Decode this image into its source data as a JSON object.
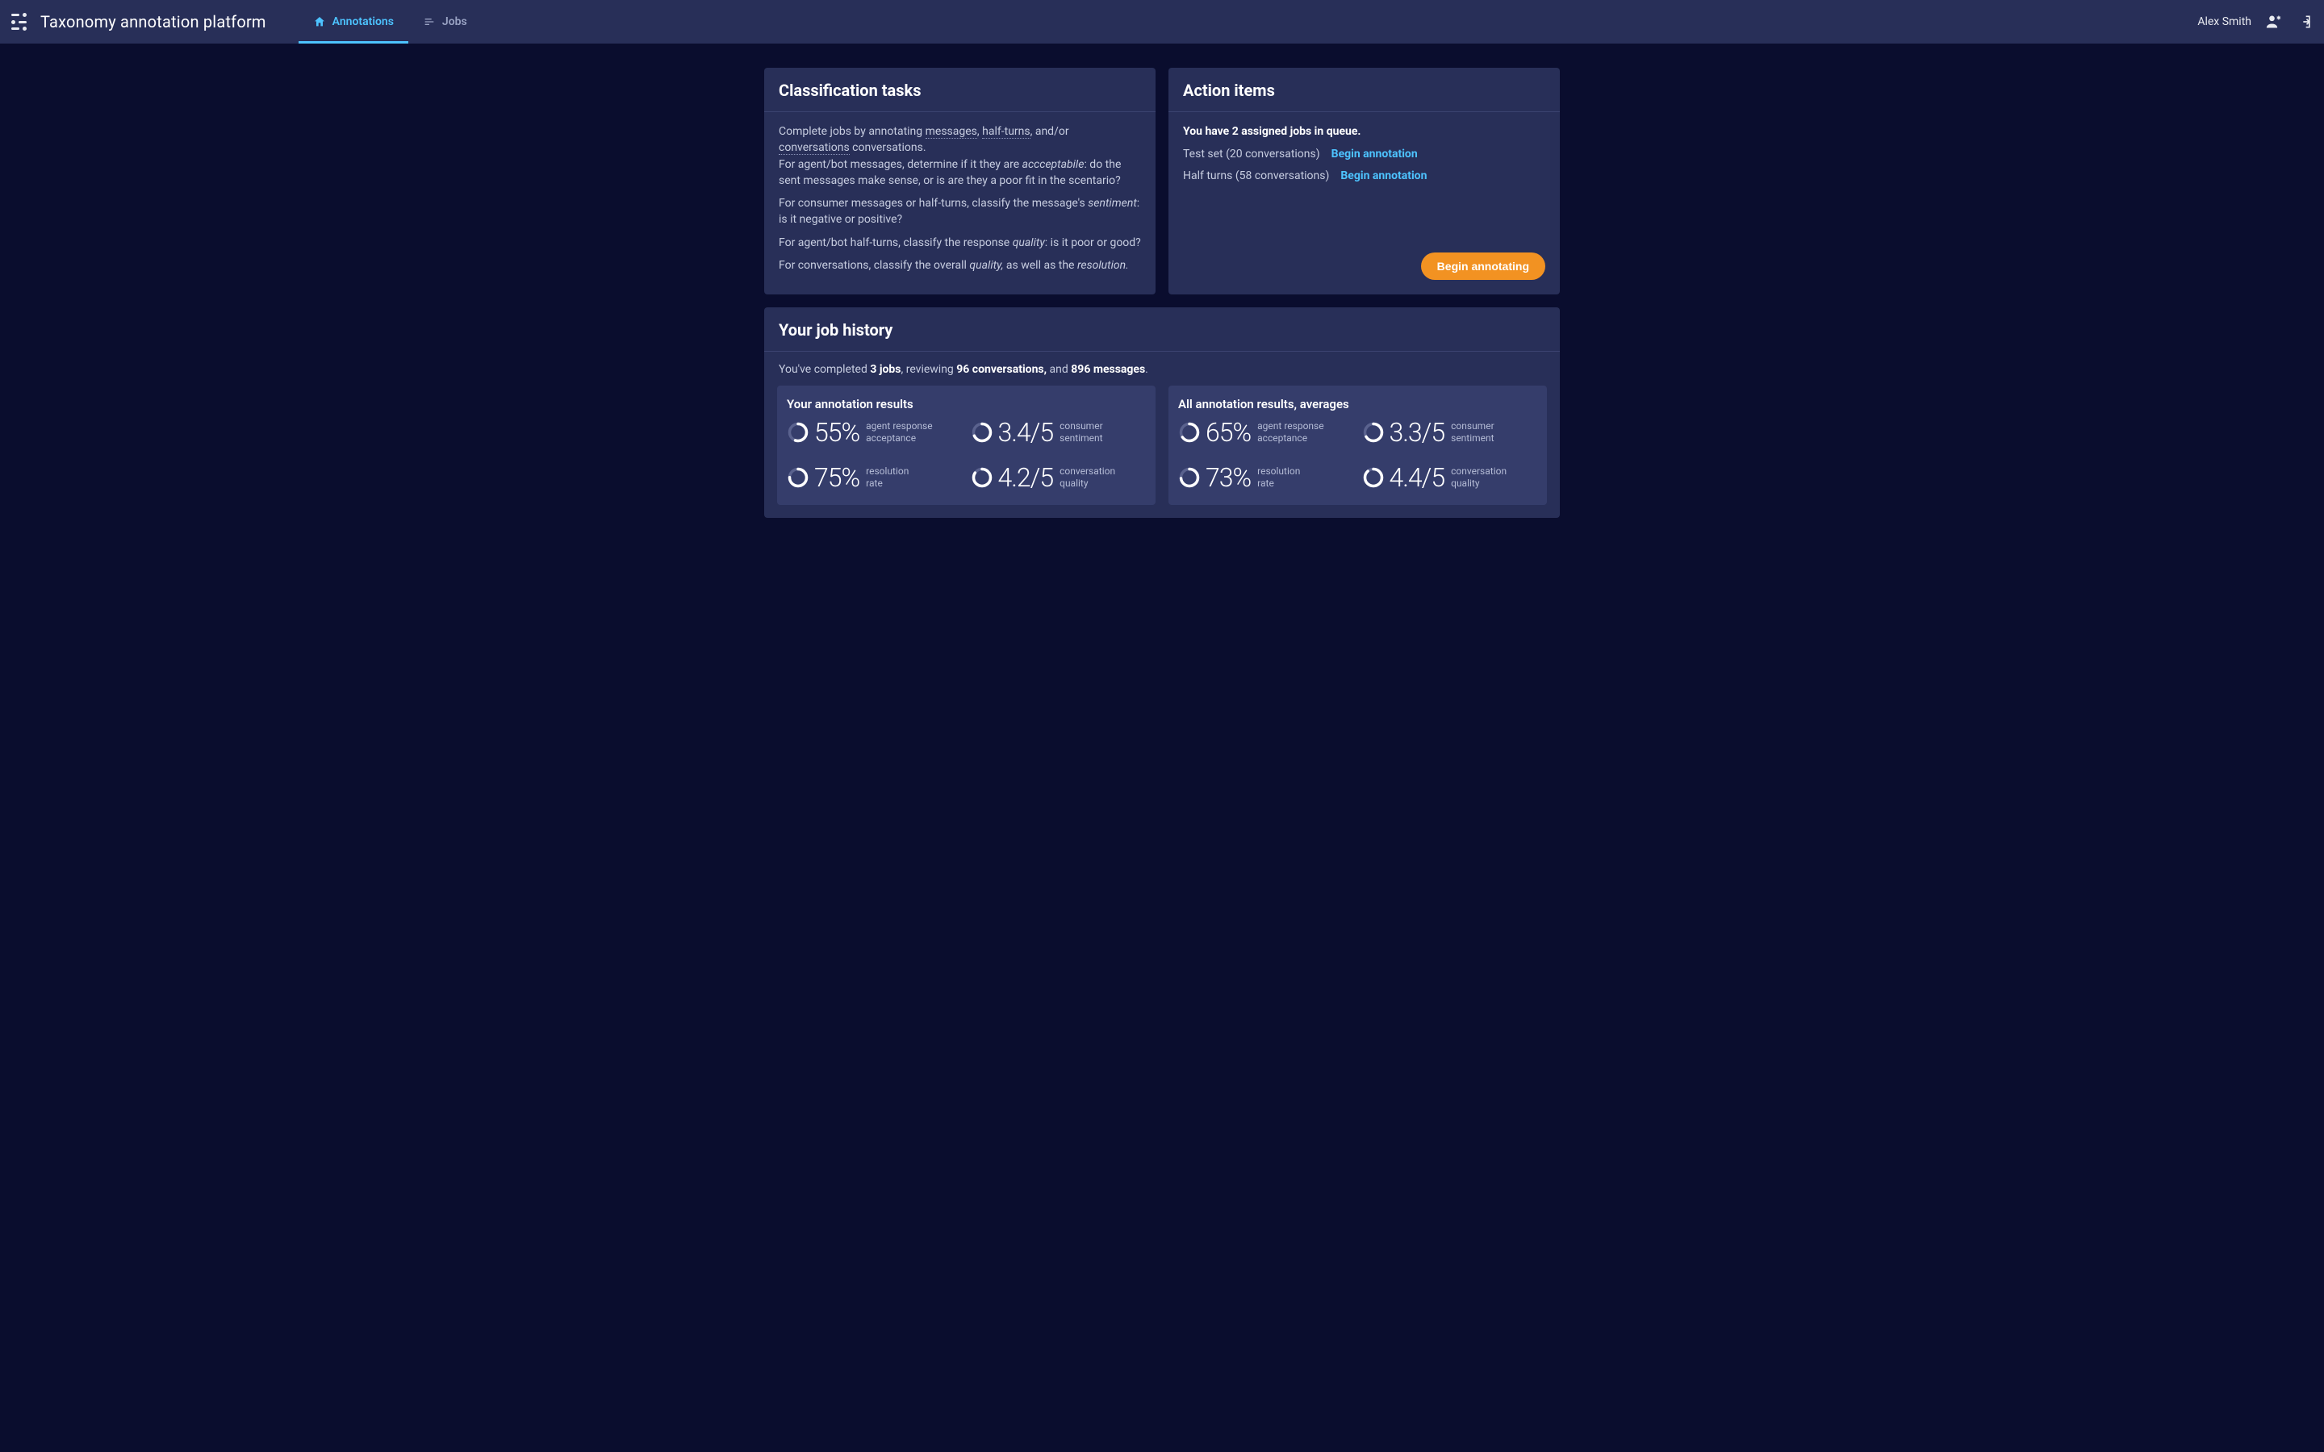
{
  "header": {
    "app_title": "Taxonomy annotation platform",
    "tabs": [
      {
        "label": "Annotations",
        "icon": "home-icon",
        "active": true
      },
      {
        "label": "Jobs",
        "icon": "list-icon",
        "active": false
      }
    ],
    "user_name": "Alex Smith"
  },
  "classification": {
    "title": "Classification tasks",
    "p1_pre": "Complete jobs by annotating ",
    "underline_messages": "messages",
    "p1_comma1": ", ",
    "underline_halfturns": "half-turns",
    "p1_andor": ", and/or ",
    "underline_conversations": "conversations",
    "p1_post": " conversations.",
    "p2_pre": "For agent/bot messages, determine if it they are ",
    "p2_italic": "accceptabile",
    "p2_post": ": do the sent messages make sense, or is are they a poor fit in the scentario?",
    "p3_pre": "For consumer messages or half-turns, classify the message's ",
    "p3_italic": "sentiment",
    "p3_post": ": is it negative or positive?",
    "p4_pre": "For agent/bot half-turns, classify the response ",
    "p4_italic": "quality",
    "p4_post": ": is it poor or good?",
    "p5_pre": "For conversations, classify the overall ",
    "p5_italic1": "quality,",
    "p5_mid": " as well as the ",
    "p5_italic2": "resolution."
  },
  "action_items": {
    "title": "Action items",
    "queue_pre": "You have ",
    "queue_count": "2",
    "queue_post": " assigned jobs in queue.",
    "items": [
      {
        "label": "Test set (20 conversations)",
        "link": "Begin annotation"
      },
      {
        "label": "Half turns (58 conversations)",
        "link": "Begin annotation"
      }
    ],
    "primary_button": "Begin annotating"
  },
  "history": {
    "title": "Your job history",
    "summary_pre": "You've completed ",
    "summary_jobs": "3 jobs",
    "summary_mid1": ", reviewing ",
    "summary_conversations": "96 conversations,",
    "summary_mid2": " and ",
    "summary_messages": "896 messages",
    "summary_post": ".",
    "your_results": {
      "title": "Your annotation results",
      "stats": [
        {
          "value": "55%",
          "label_l1": "agent response",
          "label_l2": "acceptance",
          "fill": 55
        },
        {
          "value": "3.4/5",
          "label_l1": "consumer",
          "label_l2": "sentiment",
          "fill": 68
        },
        {
          "value": "75%",
          "label_l1": "resolution",
          "label_l2": "rate",
          "fill": 75
        },
        {
          "value": "4.2/5",
          "label_l1": "conversation",
          "label_l2": "quality",
          "fill": 84
        }
      ]
    },
    "all_results": {
      "title": "All annotation results, averages",
      "stats": [
        {
          "value": "65%",
          "label_l1": "agent response",
          "label_l2": "acceptance",
          "fill": 65
        },
        {
          "value": "3.3/5",
          "label_l1": "consumer",
          "label_l2": "sentiment",
          "fill": 66
        },
        {
          "value": "73%",
          "label_l1": "resolution",
          "label_l2": "rate",
          "fill": 73
        },
        {
          "value": "4.4/5",
          "label_l1": "conversation",
          "label_l2": "quality",
          "fill": 88
        }
      ]
    }
  },
  "colors": {
    "accent": "#4dc3ff",
    "primary": "#f29222",
    "bg": "#0a0d2e",
    "panel": "#282f58",
    "panel_inner": "#353d6b"
  }
}
